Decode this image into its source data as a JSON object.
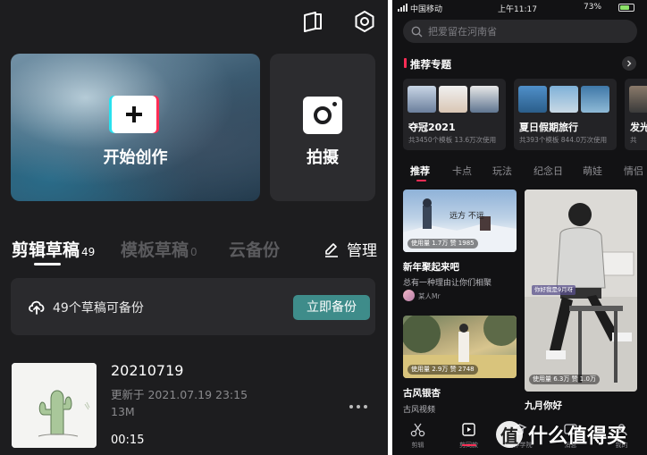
{
  "left": {
    "create_label": "开始创作",
    "shoot_label": "拍摄",
    "tabs": [
      {
        "label": "剪辑草稿",
        "count": "49"
      },
      {
        "label": "模板草稿",
        "count": "0"
      },
      {
        "label": "云备份",
        "count": ""
      }
    ],
    "manage_label": "管理",
    "backup": {
      "text": "49个草稿可备份",
      "button": "立即备份"
    },
    "draft": {
      "title": "20210719",
      "updated": "更新于 2021.07.19 23:15",
      "size": "13M",
      "duration": "00:15"
    }
  },
  "right": {
    "status": {
      "carrier": "中国移动",
      "time": "上午11:17",
      "battery": "73%",
      "battery_level": 0.73
    },
    "search": {
      "placeholder": "把爱留在河南省"
    },
    "topics": {
      "title": "推荐专题",
      "cards": [
        {
          "title": "夺冠2021",
          "meta": "共3450个模板 13.6万次使用"
        },
        {
          "title": "夏日假期旅行",
          "meta": "共393个模板 844.0万次使用"
        },
        {
          "title": "发光",
          "meta": "共"
        }
      ]
    },
    "tabs": [
      "推荐",
      "卡点",
      "玩法",
      "纪念日",
      "萌娃",
      "情侣"
    ],
    "feed": [
      {
        "title": "新年聚起来吧",
        "desc": "总有一种理由让你们相聚",
        "author": "某人Mr",
        "usage": "使用量 1.7万 赞 1985",
        "overlay": "远方 不远"
      },
      {
        "title": "九月你好",
        "usage": "使用量 6.3万 赞 1.0万",
        "overlay": "你好我是9月呀"
      },
      {
        "title": "古风银杏",
        "desc": "古风视频",
        "usage": "使用量 2.9万 赞 2748"
      }
    ],
    "bottom_nav": [
      "剪辑",
      "剪同款",
      "创作学院",
      "消息",
      "我的"
    ]
  },
  "watermark": {
    "badge": "值",
    "text": "什么值得买"
  },
  "colors": {
    "accent_red": "#fd2d55",
    "accent_cyan": "#29e1ee",
    "backup_button": "#3e8c8a"
  }
}
